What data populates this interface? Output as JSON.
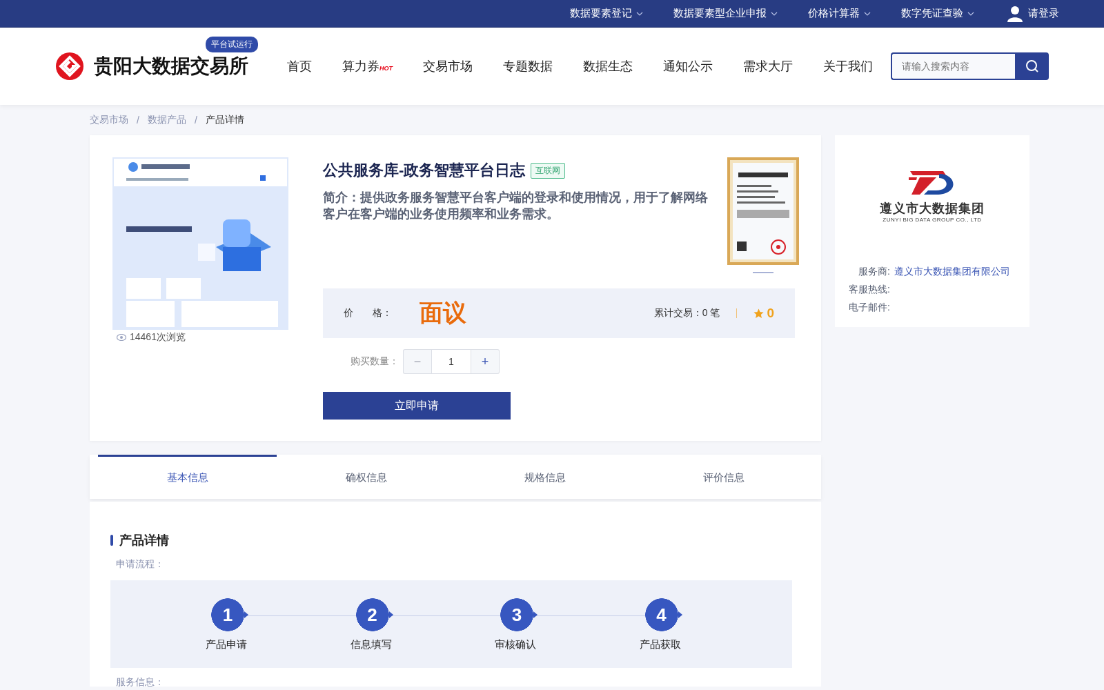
{
  "top_nav": [
    {
      "label": "数据要素登记",
      "has_dropdown": true
    },
    {
      "label": "数据要素型企业申报",
      "has_dropdown": true
    },
    {
      "label": "价格计算器",
      "has_dropdown": true
    },
    {
      "label": "数字凭证查验",
      "has_dropdown": true
    }
  ],
  "login": "请登录",
  "brand": {
    "name": "贵阳大数据交易所",
    "badge": "平台试运行"
  },
  "main_nav": [
    {
      "label": "首页"
    },
    {
      "label": "算力券",
      "badge": "HOT"
    },
    {
      "label": "交易市场"
    },
    {
      "label": "专题数据"
    },
    {
      "label": "数据生态"
    },
    {
      "label": "通知公示"
    },
    {
      "label": "需求大厅"
    },
    {
      "label": "关于我们"
    }
  ],
  "search": {
    "placeholder": "请输入搜索内容"
  },
  "breadcrumb": [
    {
      "label": "交易市场",
      "current": false
    },
    {
      "label": "数据产品",
      "current": false
    },
    {
      "label": "产品详情",
      "current": true
    }
  ],
  "breadcrumb_separators": [
    "/",
    "/"
  ],
  "product": {
    "title": "公共服务库-政务智慧平台日志",
    "tag": "互联网",
    "intro": "简介：提供政务服务智慧平台客户端的登录和使用情况，用于了解网络客户在客户端的业务使用频率和业务需求。",
    "views": "14461次浏览",
    "price_label": "价　　格：",
    "price": "面议",
    "trades": "累计交易：0 笔",
    "rating": "0",
    "quantity_label": "购买数量：",
    "quantity": "1",
    "decrement": {
      "label": "−",
      "disabled": true
    },
    "increment": {
      "label": "+",
      "disabled": false
    },
    "apply": "立即申请"
  },
  "vendor": {
    "logo_name": "遵义市大数据集团",
    "logo_en": "ZUNYI BIG DATA GROUP CO., LTD",
    "fields": [
      {
        "label": "服务商:",
        "value": "遵义市大数据集团有限公司"
      },
      {
        "label": "客服热线:"
      },
      {
        "label": "电子邮件:"
      }
    ]
  },
  "tabs": [
    {
      "label": "基本信息",
      "selected": true
    },
    {
      "label": "确权信息",
      "selected": false
    },
    {
      "label": "规格信息",
      "selected": false
    },
    {
      "label": "评价信息",
      "selected": false
    }
  ],
  "details": {
    "title": "产品详情",
    "process_label": "申请流程：",
    "steps": [
      {
        "number": "1",
        "label": "产品申请"
      },
      {
        "number": "2",
        "label": "信息填写"
      },
      {
        "number": "3",
        "label": "审核确认"
      },
      {
        "number": "4",
        "label": "产品获取"
      }
    ],
    "next_label": "服务信息："
  }
}
